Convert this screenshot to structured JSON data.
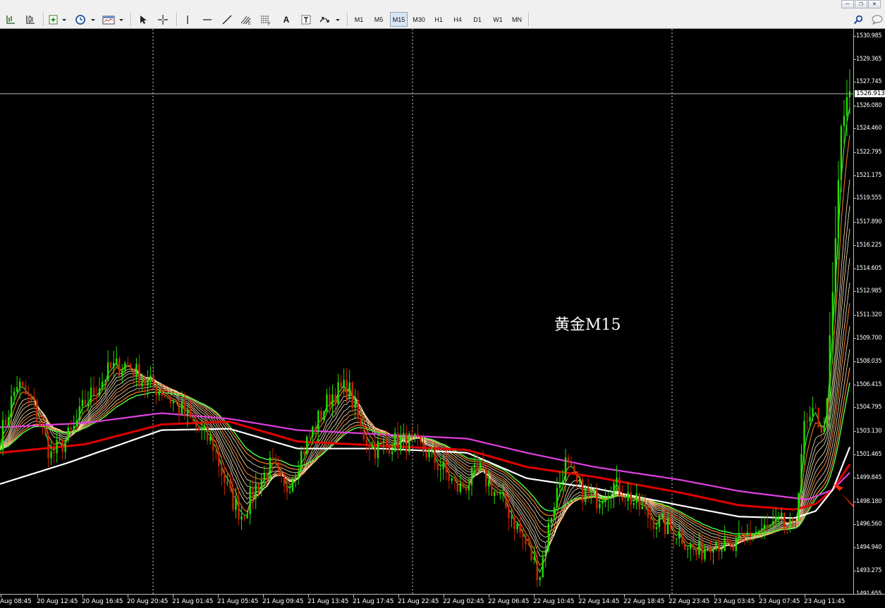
{
  "window_controls": {
    "minimize": "–",
    "restore": "❐",
    "close": "✕"
  },
  "toolbar": {
    "tools": [
      "bar-chart-icon",
      "candlestick-icon",
      "add-indicator-icon",
      "clock-icon",
      "templates-icon",
      "cursor-icon",
      "crosshair-icon",
      "vertical-line-icon",
      "horizontal-line-icon",
      "trendline-icon",
      "pitchfork-icon",
      "fibonacci-icon",
      "text-tool-icon",
      "text-label-icon",
      "arrows-icon"
    ],
    "text_tool_label": "A",
    "timeframes": [
      "M1",
      "M5",
      "M15",
      "M30",
      "H1",
      "H4",
      "D1",
      "W1",
      "MN"
    ],
    "active_timeframe": "M15",
    "right_icons": [
      "search-icon",
      "chat-icon"
    ]
  },
  "chart": {
    "title": "黄金M15",
    "current_price": "1526.913",
    "price_labels": [
      "1530.985",
      "1529.365",
      "1527.745",
      "1526.080",
      "1524.460",
      "1522.795",
      "1521.175",
      "1519.555",
      "1517.890",
      "1516.225",
      "1514.605",
      "1512.985",
      "1511.320",
      "1509.700",
      "1508.035",
      "1506.415",
      "1504.795",
      "1503.130",
      "1501.465",
      "1499.845",
      "1498.180",
      "1496.560",
      "1494.940",
      "1493.275",
      "1491.655"
    ],
    "time_labels": [
      "Aug 08:45",
      "20 Aug 12:45",
      "20 Aug 16:45",
      "20 Aug 20:45",
      "21 Aug 01:45",
      "21 Aug 05:45",
      "21 Aug 09:45",
      "21 Aug 13:45",
      "21 Aug 17:45",
      "21 Aug 22:45",
      "22 Aug 02:45",
      "22 Aug 06:45",
      "22 Aug 10:45",
      "22 Aug 14:45",
      "22 Aug 18:45",
      "22 Aug 23:45",
      "23 Aug 03:45",
      "23 Aug 07:45",
      "23 Aug 11:45"
    ],
    "colors": {
      "background": "#000000",
      "candle": "#22dd00",
      "candle_down": "#cc2200",
      "ma_slow_magenta": "#e040e0",
      "ma_red": "#e00000",
      "ma_white": "#ffffff",
      "ribbon_light": "#ffe8c0",
      "ribbon_orange": "#ff8020",
      "ribbon_green": "#50ff50",
      "arrow": "#ff2a00"
    }
  },
  "chart_data": {
    "type": "candlestick",
    "symbol_title": "黄金M15",
    "y_range": [
      1491.655,
      1531.8
    ],
    "y_ticks": [
      1530.985,
      1529.365,
      1527.745,
      1526.08,
      1524.46,
      1522.795,
      1521.175,
      1519.555,
      1517.89,
      1516.225,
      1514.605,
      1512.985,
      1511.32,
      1509.7,
      1508.035,
      1506.415,
      1504.795,
      1503.13,
      1501.465,
      1499.845,
      1498.18,
      1496.56,
      1494.94,
      1493.275,
      1491.655
    ],
    "x_ticks": [
      "Aug 08:45",
      "20 Aug 12:45",
      "20 Aug 16:45",
      "20 Aug 20:45",
      "21 Aug 01:45",
      "21 Aug 05:45",
      "21 Aug 09:45",
      "21 Aug 13:45",
      "21 Aug 17:45",
      "21 Aug 22:45",
      "22 Aug 02:45",
      "22 Aug 06:45",
      "22 Aug 10:45",
      "22 Aug 14:45",
      "22 Aug 18:45",
      "22 Aug 23:45",
      "23 Aug 03:45",
      "23 Aug 07:45",
      "23 Aug 11:45"
    ],
    "last_price": 1526.913,
    "close_path": [
      [
        0,
        1502.6
      ],
      [
        0.02,
        1506.5
      ],
      [
        0.04,
        1504.8
      ],
      [
        0.06,
        1501.4
      ],
      [
        0.085,
        1503.0
      ],
      [
        0.1,
        1505.1
      ],
      [
        0.13,
        1507.5
      ],
      [
        0.15,
        1507.9
      ],
      [
        0.17,
        1506.6
      ],
      [
        0.19,
        1506.0
      ],
      [
        0.21,
        1504.8
      ],
      [
        0.23,
        1503.4
      ],
      [
        0.25,
        1502.3
      ],
      [
        0.27,
        1498.6
      ],
      [
        0.285,
        1497.2
      ],
      [
        0.3,
        1499.1
      ],
      [
        0.32,
        1500.8
      ],
      [
        0.335,
        1498.8
      ],
      [
        0.355,
        1501.6
      ],
      [
        0.375,
        1504.0
      ],
      [
        0.39,
        1505.7
      ],
      [
        0.41,
        1506.2
      ],
      [
        0.425,
        1503.2
      ],
      [
        0.44,
        1501.9
      ],
      [
        0.46,
        1502.3
      ],
      [
        0.48,
        1502.4
      ],
      [
        0.5,
        1501.8
      ],
      [
        0.52,
        1500.5
      ],
      [
        0.54,
        1499.0
      ],
      [
        0.565,
        1500.3
      ],
      [
        0.585,
        1498.6
      ],
      [
        0.6,
        1497.4
      ],
      [
        0.62,
        1495.0
      ],
      [
        0.635,
        1493.0
      ],
      [
        0.65,
        1497.7
      ],
      [
        0.665,
        1500.9
      ],
      [
        0.68,
        1499.1
      ],
      [
        0.7,
        1498.3
      ],
      [
        0.72,
        1499.4
      ],
      [
        0.74,
        1498.5
      ],
      [
        0.76,
        1497.3
      ],
      [
        0.78,
        1496.5
      ],
      [
        0.8,
        1495.9
      ],
      [
        0.82,
        1494.4
      ],
      [
        0.84,
        1495.6
      ],
      [
        0.86,
        1494.6
      ],
      [
        0.88,
        1495.9
      ],
      [
        0.9,
        1496.2
      ],
      [
        0.92,
        1496.6
      ],
      [
        0.935,
        1496.0
      ],
      [
        0.945,
        1503.1
      ],
      [
        0.96,
        1504.3
      ],
      [
        0.97,
        1503.0
      ],
      [
        0.98,
        1512.5
      ],
      [
        0.99,
        1524.5
      ],
      [
        1.0,
        1526.9
      ]
    ],
    "moving_averages": [
      {
        "color": "#e040e0",
        "path": [
          [
            0,
            1503.4
          ],
          [
            0.1,
            1503.7
          ],
          [
            0.19,
            1504.4
          ],
          [
            0.27,
            1504.0
          ],
          [
            0.35,
            1503.2
          ],
          [
            0.45,
            1502.9
          ],
          [
            0.55,
            1502.6
          ],
          [
            0.62,
            1501.6
          ],
          [
            0.7,
            1500.6
          ],
          [
            0.8,
            1499.7
          ],
          [
            0.87,
            1498.9
          ],
          [
            0.95,
            1498.3
          ],
          [
            0.98,
            1499.0
          ],
          [
            1.0,
            1500.2
          ]
        ]
      },
      {
        "color": "#e00000",
        "path": [
          [
            0,
            1501.6
          ],
          [
            0.1,
            1502.2
          ],
          [
            0.19,
            1503.6
          ],
          [
            0.27,
            1503.8
          ],
          [
            0.35,
            1502.4
          ],
          [
            0.45,
            1502.1
          ],
          [
            0.55,
            1501.8
          ],
          [
            0.62,
            1500.6
          ],
          [
            0.7,
            1499.9
          ],
          [
            0.8,
            1498.8
          ],
          [
            0.87,
            1497.9
          ],
          [
            0.935,
            1497.6
          ],
          [
            0.96,
            1498.0
          ],
          [
            0.98,
            1499.0
          ],
          [
            1.0,
            1500.8
          ]
        ]
      },
      {
        "color": "#ffffff",
        "path": [
          [
            0,
            1499.4
          ],
          [
            0.08,
            1500.9
          ],
          [
            0.19,
            1503.2
          ],
          [
            0.27,
            1503.3
          ],
          [
            0.35,
            1501.9
          ],
          [
            0.45,
            1501.9
          ],
          [
            0.55,
            1501.6
          ],
          [
            0.62,
            1499.8
          ],
          [
            0.7,
            1499.1
          ],
          [
            0.8,
            1497.9
          ],
          [
            0.87,
            1497.1
          ],
          [
            0.935,
            1497.0
          ],
          [
            0.96,
            1497.5
          ],
          [
            0.98,
            1499.0
          ],
          [
            1.0,
            1502.0
          ]
        ]
      }
    ],
    "annotations": [
      "arrow pointing to moving averages near last bars"
    ]
  }
}
